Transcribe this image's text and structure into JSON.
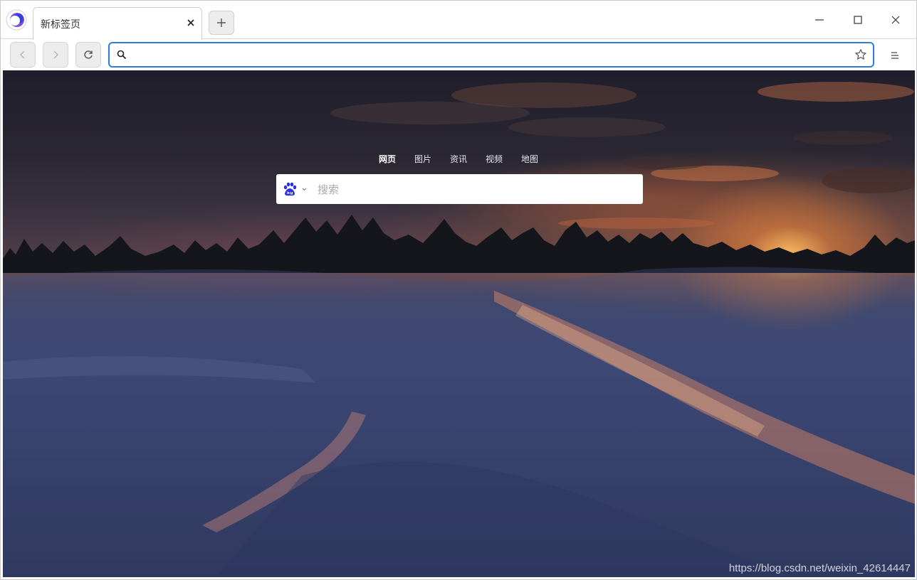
{
  "browser": {
    "tab": {
      "title": "新标签页"
    },
    "address_bar": {
      "value": "",
      "placeholder": ""
    },
    "icons": {
      "app_logo": "browser-logo-icon",
      "tab_close": "close-icon",
      "new_tab": "plus-icon",
      "minimize": "minimize-icon",
      "maximize": "maximize-icon",
      "close": "close-icon",
      "back": "chevron-left-icon",
      "forward": "chevron-right-icon",
      "reload": "reload-icon",
      "address_search": "search-icon",
      "bookmark": "star-icon",
      "menu": "menu-icon"
    },
    "colors": {
      "address_focus": "#2b7fd9",
      "nav_button_bg": "#ececec"
    }
  },
  "new_tab_page": {
    "search_categories": [
      {
        "label": "网页",
        "active": true
      },
      {
        "label": "图片",
        "active": false
      },
      {
        "label": "资讯",
        "active": false
      },
      {
        "label": "视频",
        "active": false
      },
      {
        "label": "地图",
        "active": false
      }
    ],
    "search": {
      "engine_icon": "baidu-paw-icon",
      "engine_color": "#2932e1",
      "placeholder": "搜索"
    },
    "watermark": "https://blog.csdn.net/weixin_42614447"
  }
}
